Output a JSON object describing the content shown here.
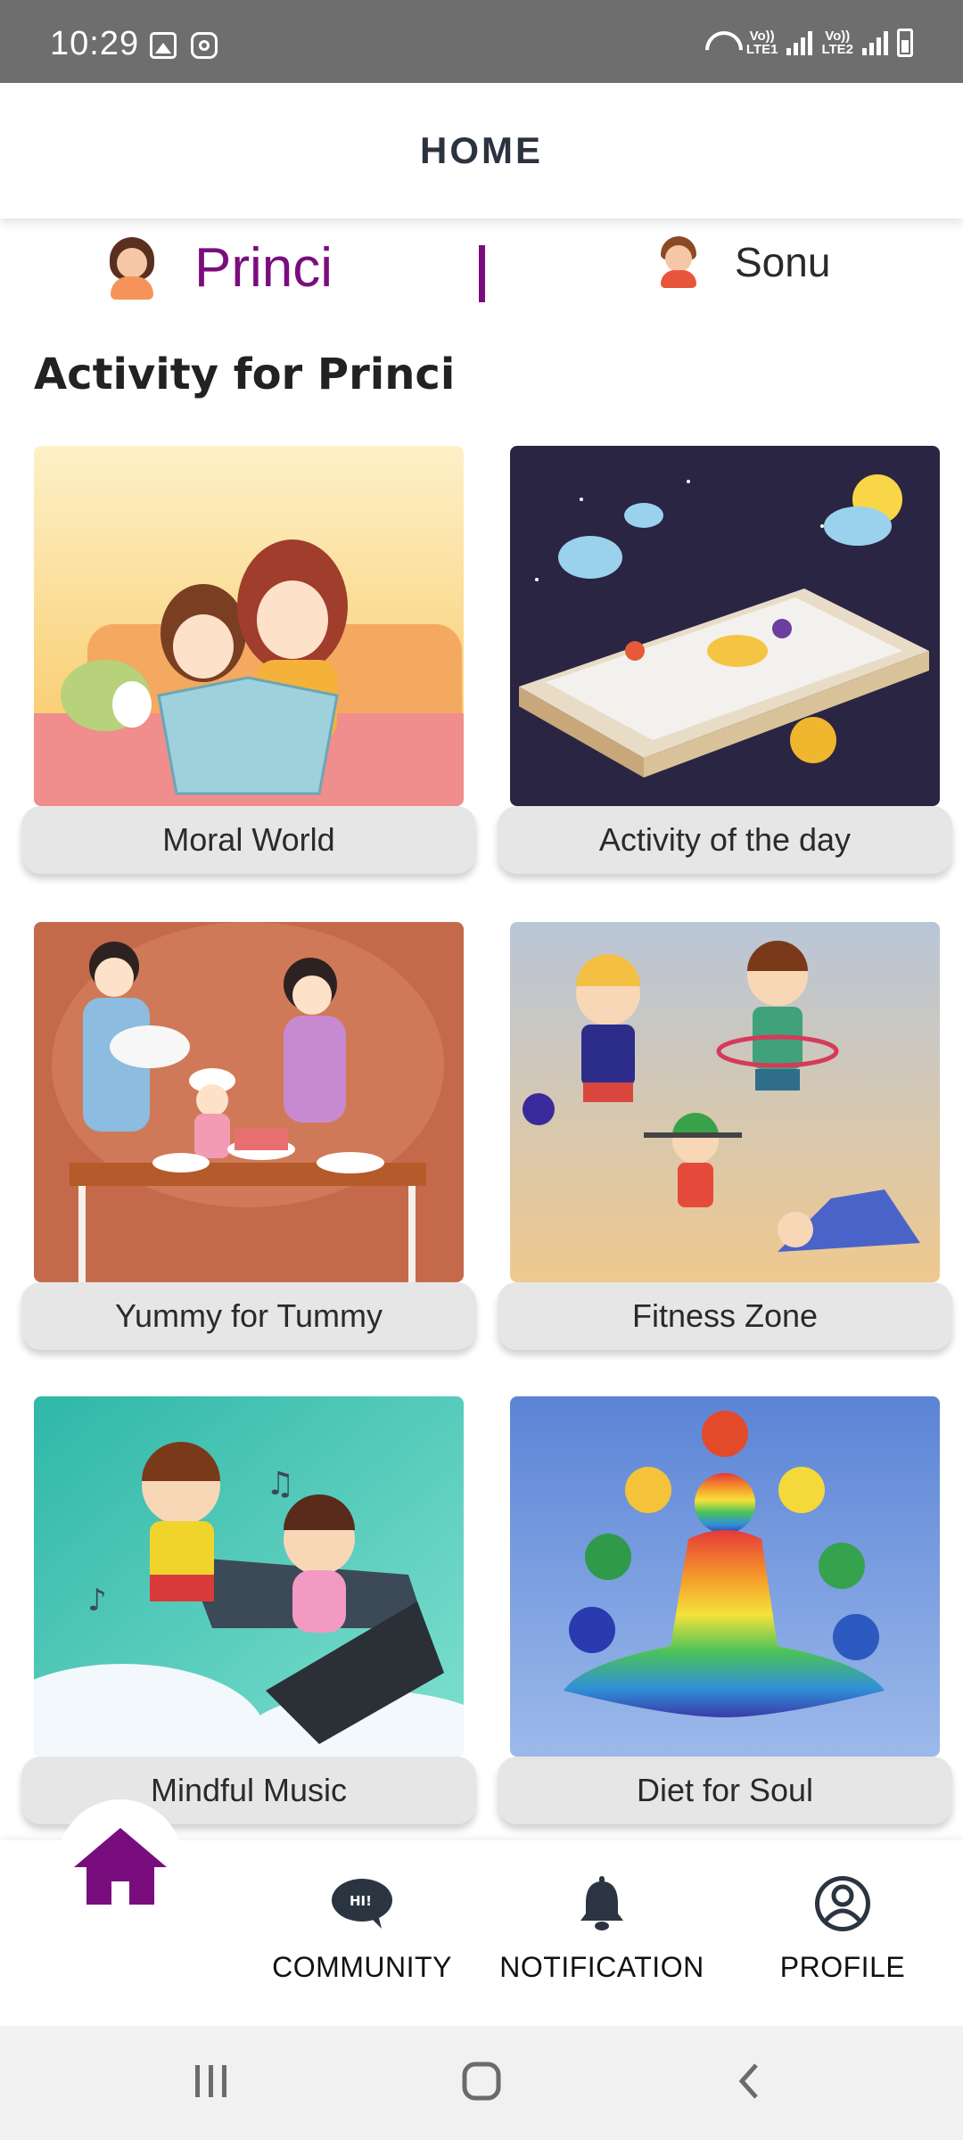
{
  "status_bar": {
    "time": "10:29",
    "sim1": "LTE1",
    "sim2": "LTE2",
    "volte": "Vo))"
  },
  "header": {
    "title": "HOME"
  },
  "kids": [
    {
      "name": "Princi",
      "selected": true
    },
    {
      "name": "Sonu",
      "selected": false
    }
  ],
  "section_title": "Activity for Princi",
  "activities": [
    {
      "label": "Moral World",
      "image": "mother-reading-book-illustration"
    },
    {
      "label": "Activity of the day",
      "image": "kids-playing-on-phone-illustration"
    },
    {
      "label": "Yummy for Tummy",
      "image": "family-baking-cake-illustration"
    },
    {
      "label": "Fitness Zone",
      "image": "kids-exercising-illustration"
    },
    {
      "label": "Mindful Music",
      "image": "kids-listening-music-illustration"
    },
    {
      "label": "Diet for Soul",
      "image": "meditation-chakra-illustration"
    }
  ],
  "bottom_nav": {
    "home_icon": "home-icon",
    "items": [
      {
        "label": "COMMUNITY",
        "icon": "chat-bubble-icon"
      },
      {
        "label": "NOTIFICATION",
        "icon": "bell-icon"
      },
      {
        "label": "PROFILE",
        "icon": "user-circle-icon"
      }
    ]
  },
  "colors": {
    "accent": "#7a0d7e",
    "status_bar": "#6e6e6e",
    "card_label_bg": "#e6e6e6",
    "nav_icon": "#2b3542"
  }
}
